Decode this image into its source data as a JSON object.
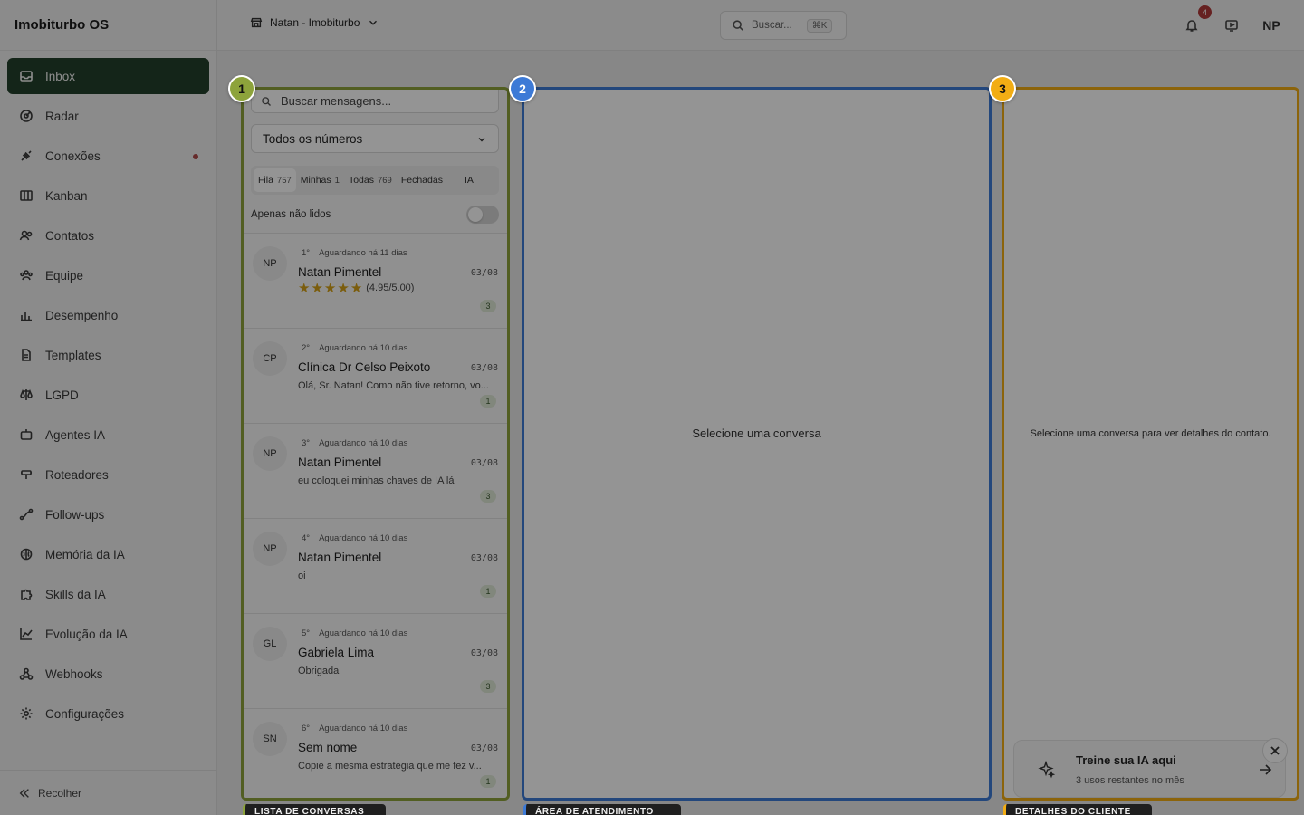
{
  "brand": "Imobiturbo OS",
  "sidebar": {
    "items": [
      {
        "label": "Inbox",
        "icon": "inbox-icon"
      },
      {
        "label": "Radar",
        "icon": "radar-icon"
      },
      {
        "label": "Conexões",
        "icon": "plug-icon"
      },
      {
        "label": "Kanban",
        "icon": "kanban-icon"
      },
      {
        "label": "Contatos",
        "icon": "contacts-icon"
      },
      {
        "label": "Equipe",
        "icon": "team-icon"
      },
      {
        "label": "Desempenho",
        "icon": "bar-chart-icon"
      },
      {
        "label": "Templates",
        "icon": "document-icon"
      },
      {
        "label": "LGPD",
        "icon": "scale-icon"
      },
      {
        "label": "Agentes IA",
        "icon": "bot-icon"
      },
      {
        "label": "Roteadores",
        "icon": "router-icon"
      },
      {
        "label": "Follow-ups",
        "icon": "route-icon"
      },
      {
        "label": "Memória da IA",
        "icon": "brain-icon"
      },
      {
        "label": "Skills da IA",
        "icon": "puzzle-icon"
      },
      {
        "label": "Evolução da IA",
        "icon": "trend-icon"
      },
      {
        "label": "Webhooks",
        "icon": "webhook-icon"
      },
      {
        "label": "Configurações",
        "icon": "gear-icon"
      }
    ],
    "collapse_label": "Recolher"
  },
  "topbar": {
    "account_label": "Natan - Imobiturbo",
    "search_placeholder": "Buscar...",
    "search_shortcut": "⌘K",
    "notifications_count": "4",
    "user_initials": "NP"
  },
  "conversations": {
    "search_placeholder": "Buscar mensagens...",
    "number_filter": "Todos os números",
    "tabs": [
      {
        "label": "Fila",
        "count": "757"
      },
      {
        "label": "Minhas",
        "count": "1"
      },
      {
        "label": "Todas",
        "count": "769"
      },
      {
        "label": "Fechadas",
        "count": ""
      },
      {
        "label": "IA",
        "count": ""
      }
    ],
    "unread_only_label": "Apenas não lidos",
    "items": [
      {
        "initials": "NP",
        "position": "1°",
        "waiting": "Aguardando há 11 dias",
        "name": "Natan Pimentel",
        "date": "03/08",
        "preview": "",
        "rating": "(4.95/5.00)",
        "unread": "3"
      },
      {
        "initials": "CP",
        "position": "2°",
        "waiting": "Aguardando há 10 dias",
        "name": "Clínica Dr Celso Peixoto",
        "date": "03/08",
        "preview": "Olá, Sr. Natan! Como não tive retorno, vo...",
        "unread": "1"
      },
      {
        "initials": "NP",
        "position": "3°",
        "waiting": "Aguardando há 10 dias",
        "name": "Natan Pimentel",
        "date": "03/08",
        "preview": "eu coloquei minhas chaves de IA lá",
        "unread": "3"
      },
      {
        "initials": "NP",
        "position": "4°",
        "waiting": "Aguardando há 10 dias",
        "name": "Natan Pimentel",
        "date": "03/08",
        "preview": "oi",
        "unread": "1"
      },
      {
        "initials": "GL",
        "position": "5°",
        "waiting": "Aguardando há 10 dias",
        "name": "Gabriela Lima",
        "date": "03/08",
        "preview": "Obrigada",
        "unread": "3"
      },
      {
        "initials": "SN",
        "position": "6°",
        "waiting": "Aguardando há 10 dias",
        "name": "Sem nome",
        "date": "03/08",
        "preview": "Copie a mesma estratégia que me fez v...",
        "unread": "1"
      }
    ]
  },
  "chat_area": {
    "empty_text": "Selecione uma conversa"
  },
  "details": {
    "empty_text": "Selecione uma conversa para ver detalhes do contato.",
    "train_card_title": "Treine sua IA aqui",
    "train_card_subtitle": "3 usos restantes no mês"
  },
  "tour": {
    "markers": [
      "1",
      "2",
      "3"
    ],
    "tags": [
      "LISTA DE CONVERSAS",
      "ÁREA DE ATENDIMENTO",
      "DETALHES DO CLIENTE"
    ]
  },
  "colors": {
    "sidebar_active": "#24412b",
    "panel1_border": "#8da33b",
    "panel2_border": "#3d7ad6",
    "panel3_border": "#f2ad14",
    "rating_star": "#d4a017"
  }
}
